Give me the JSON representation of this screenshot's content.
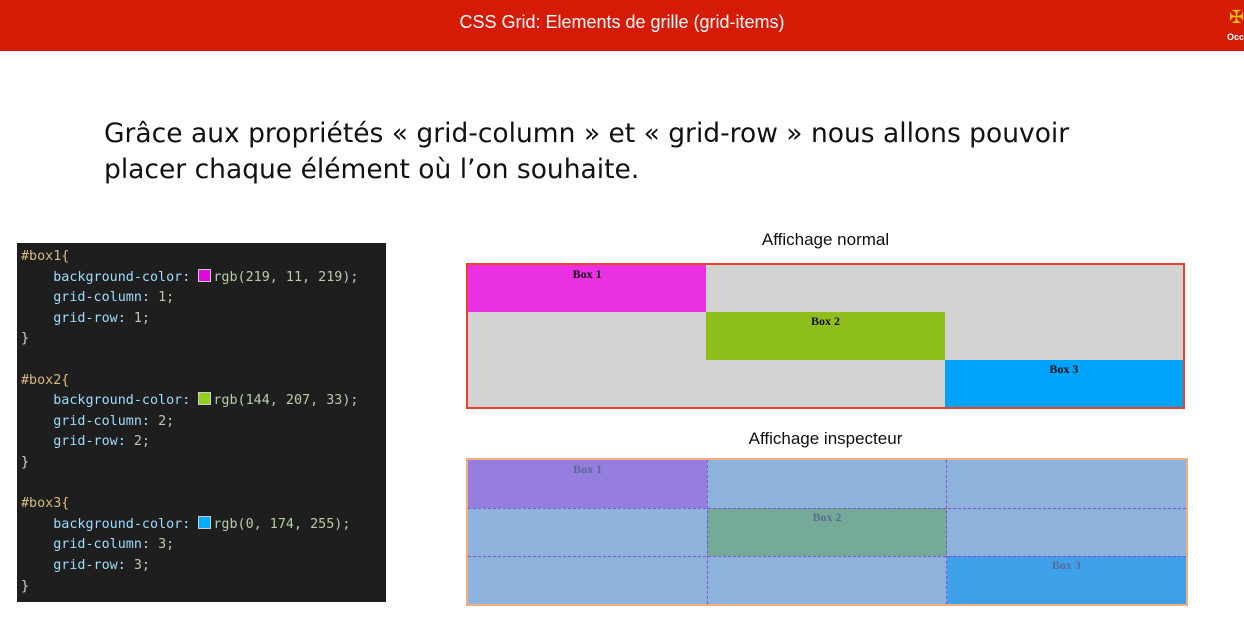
{
  "header": {
    "title": "CSS Grid: Elements de grille (grid-items)",
    "logo_text": "Occ"
  },
  "intro": {
    "line1": "Grâce aux propriétés « grid-column » et « grid-row » nous allons pouvoir",
    "line2": "placer chaque élément où l’on souhaite."
  },
  "code": {
    "rules": [
      {
        "selector": "#box1{",
        "bg_prop": "background-color:",
        "bg_value": "rgb(219, 11, 219);",
        "swatch": "#db0bdb",
        "col_prop": "grid-column:",
        "col_value": "1;",
        "row_prop": "grid-row:",
        "row_value": "1;",
        "close": "}"
      },
      {
        "selector": "#box2{",
        "bg_prop": "background-color:",
        "bg_value": "rgb(144, 207, 33);",
        "swatch": "#90cf21",
        "col_prop": "grid-column:",
        "col_value": "2;",
        "row_prop": "grid-row:",
        "row_value": "2;",
        "close": "}"
      },
      {
        "selector": "#box3{",
        "bg_prop": "background-color:",
        "bg_value": "rgb(0, 174, 255);",
        "swatch": "#00aeff",
        "col_prop": "grid-column:",
        "col_value": "3;",
        "row_prop": "grid-row:",
        "row_value": "3;",
        "close": "}"
      }
    ]
  },
  "normal": {
    "caption": "Affichage normal",
    "boxes": [
      {
        "label": "Box 1",
        "color": "#eb2fe2",
        "col": 1,
        "row": 1
      },
      {
        "label": "Box 2",
        "color": "#8fbf1c",
        "col": 2,
        "row": 2
      },
      {
        "label": "Box 3",
        "color": "#00a3fb",
        "col": 3,
        "row": 3
      }
    ]
  },
  "inspector": {
    "caption": "Affichage inspecteur",
    "boxes": [
      {
        "label": "Box 1",
        "color": "#967de0",
        "col": 1,
        "row": 1
      },
      {
        "label": "Box 2",
        "color": "#75aa98",
        "col": 2,
        "row": 2
      },
      {
        "label": "Box 3",
        "color": "#40a1eb",
        "col": 3,
        "row": 3
      }
    ]
  }
}
